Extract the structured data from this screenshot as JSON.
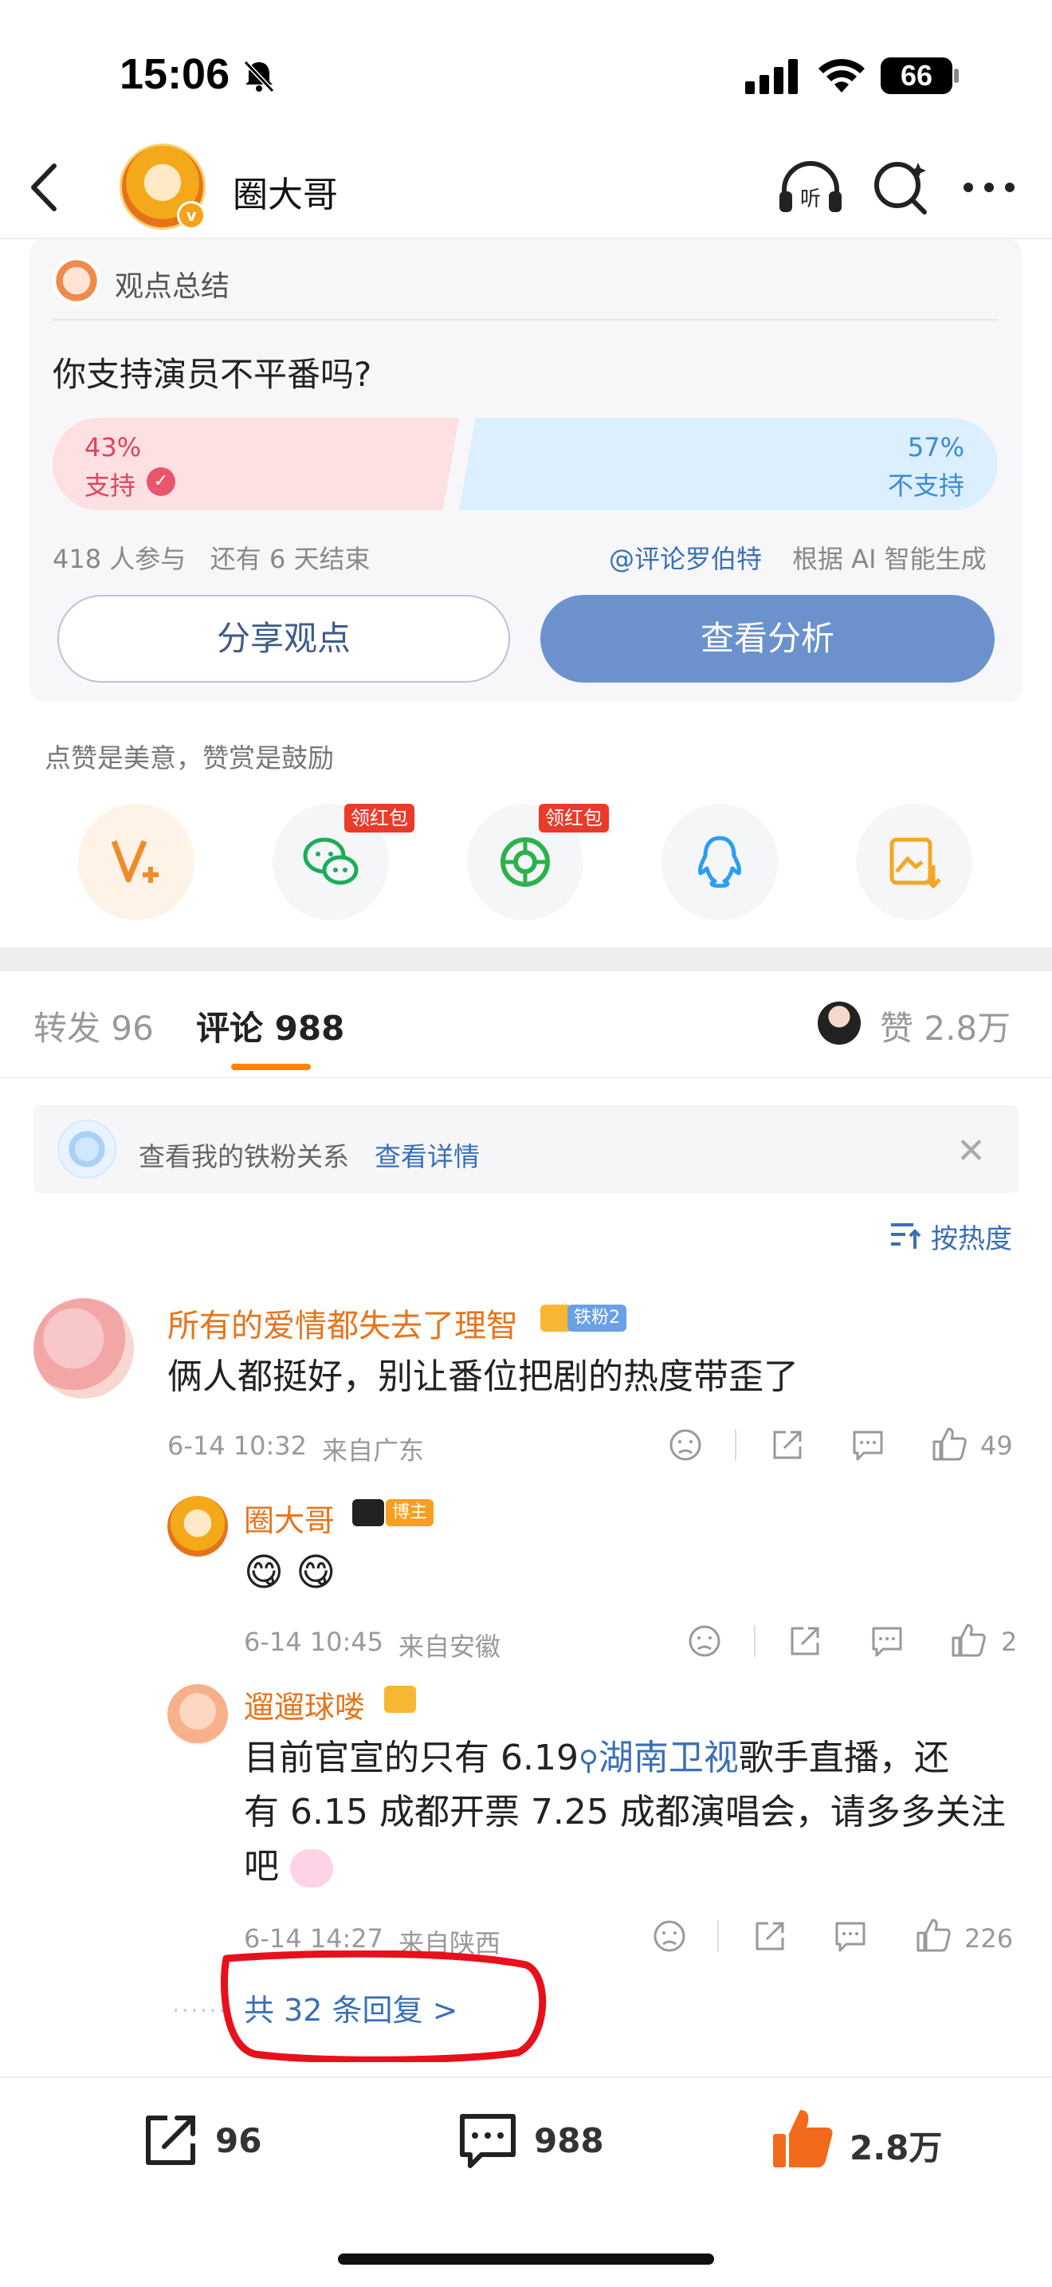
{
  "status_bar": {
    "time": "15:06",
    "battery": "66"
  },
  "nav": {
    "title": "圈大哥"
  },
  "poll": {
    "header": "观点总结",
    "question": "你支持演员不平番吗?",
    "support_pct": "43%",
    "support_label": "支持",
    "oppose_pct": "57%",
    "oppose_label": "不支持",
    "meta": "418 人参与   还有 6 天结束",
    "source": "@评论罗伯特",
    "source_tail": "根据 AI 智能生成",
    "share_btn": "分享观点",
    "analyze_btn": "查看分析"
  },
  "reward": {
    "tip": "点赞是美意，赞赏是鼓励",
    "wechat_badge": "领红包",
    "moments_badge": "领红包"
  },
  "tabs": {
    "repost": "转发 96",
    "comments": "评论 988",
    "likes": "赞 2.8万"
  },
  "fan_bar": {
    "text": "查看我的铁粉关系",
    "link": "查看详情"
  },
  "sort": {
    "label": "按热度"
  },
  "comments": [
    {
      "name": "所有的爱情都失去了理智",
      "tag": "铁粉2",
      "text": "俩人都挺好，别让番位把剧的热度带歪了",
      "time": "6-14 10:32",
      "location": "来自广东",
      "likes": "49"
    },
    {
      "name": "圈大哥",
      "tag": "博主",
      "text": "😋 😋",
      "time": "6-14 10:45",
      "location": "来自安徽",
      "likes": "2"
    },
    {
      "name": "遛遛球喽",
      "text_line1_a": "目前官宣的只有 6.19",
      "text_line1_link": "湖南卫视",
      "text_line1_b": "歌手直播，还",
      "text_line2": "有 6.15 成都开票 7.25 成都演唱会，请多多关注",
      "text_line3": "吧",
      "time": "6-14 14:27",
      "location": "来自陕西",
      "likes": "226"
    }
  ],
  "more_replies": "共 32 条回复 >",
  "bottom_bar": {
    "repost": "96",
    "comment": "988",
    "like": "2.8万"
  },
  "colors": {
    "accent_orange": "#ff8200",
    "link_blue": "#3a6fb8",
    "support_red": "#e0435a",
    "oppose_blue": "#3a8ad6"
  }
}
